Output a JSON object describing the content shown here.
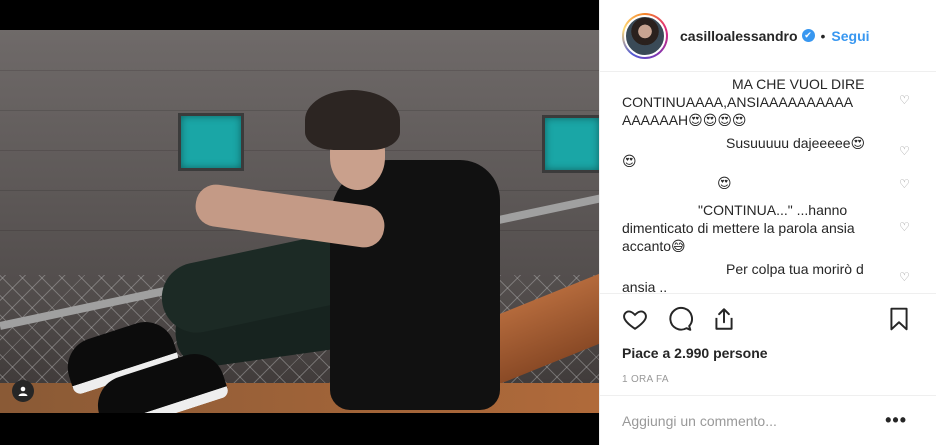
{
  "post": {
    "username": "casilloalessandro",
    "verified_mark": "✔",
    "separator": "•",
    "follow_label": "Segui",
    "likes_text": "Piace a 2.990 persone",
    "timestamp": "1 ORA FA",
    "add_comment_placeholder": "Aggiungi un commento...",
    "more_label": "•••"
  },
  "comments": [
    {
      "line1": "MA CHE VUOL DIRE",
      "line2": "CONTINUAAAA,ANSIAAAAAAAAAA",
      "line3": "AAAAAAH😍😍😍😍"
    },
    {
      "line1": "Susuuuuu dajeeeee😍",
      "line2": "😍"
    },
    {
      "line1": "😍"
    },
    {
      "line1": "\"CONTINUA...\" ...hanno",
      "line2": "dimenticato di mettere la parola ansia",
      "line3": "accanto😅"
    },
    {
      "line1": "Per colpa tua morirò d",
      "line2": "ansia .."
    }
  ],
  "icons": {
    "like": "heart-icon",
    "comment": "comment-icon",
    "share": "share-icon",
    "save": "bookmark-icon",
    "comment_like": "heart-icon",
    "tagged_user": "user-tag-icon"
  },
  "colors": {
    "accent": "#3897f0",
    "text": "#262626",
    "muted": "#999999"
  }
}
